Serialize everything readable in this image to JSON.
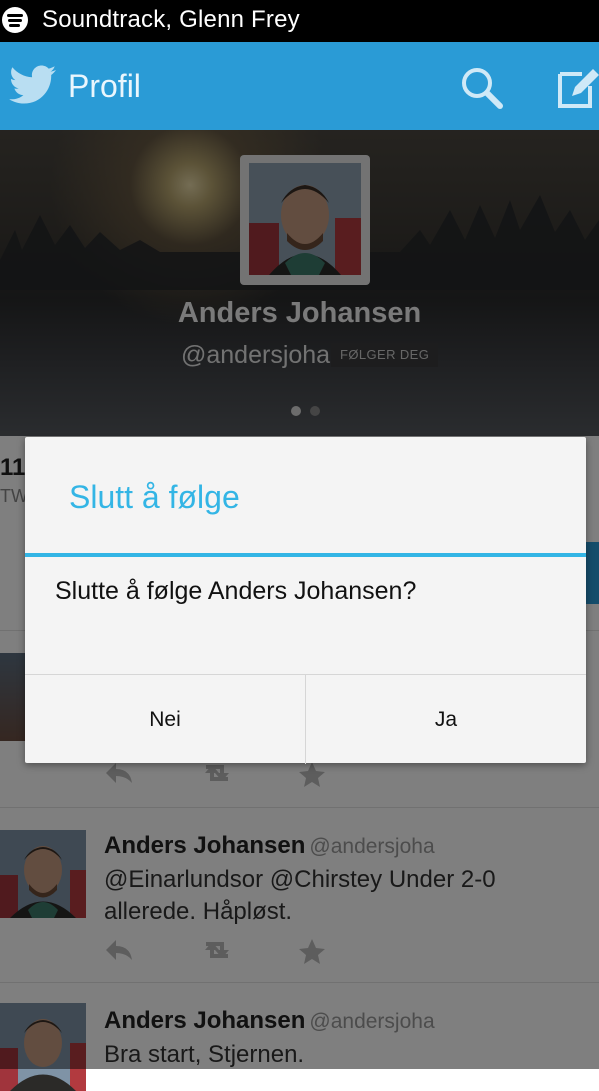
{
  "status_bar": {
    "title": "Soundtrack, Glenn Frey"
  },
  "action_bar": {
    "title": "Profil"
  },
  "profile": {
    "name": "Anders Johansen",
    "handle": "@andersjoha",
    "follows_you_badge": "FØLGER DEG"
  },
  "stats": {
    "number": "11",
    "label": "TW"
  },
  "tweets": [
    {
      "author": "Anders Johansen",
      "handle": "@andersjoha",
      "text": "@Einarlundsor @Chirstey Under 2-0 allerede. Håpløst."
    },
    {
      "author": "Anders Johansen",
      "handle": "@andersjoha",
      "text": "Bra start, Stjernen."
    }
  ],
  "dialog": {
    "title": "Slutt å følge",
    "message": "Slutte å følge Anders Johansen?",
    "no_label": "Nei",
    "yes_label": "Ja"
  },
  "colors": {
    "accent": "#33b5e5",
    "twitter_blue": "#2a9bd6"
  }
}
